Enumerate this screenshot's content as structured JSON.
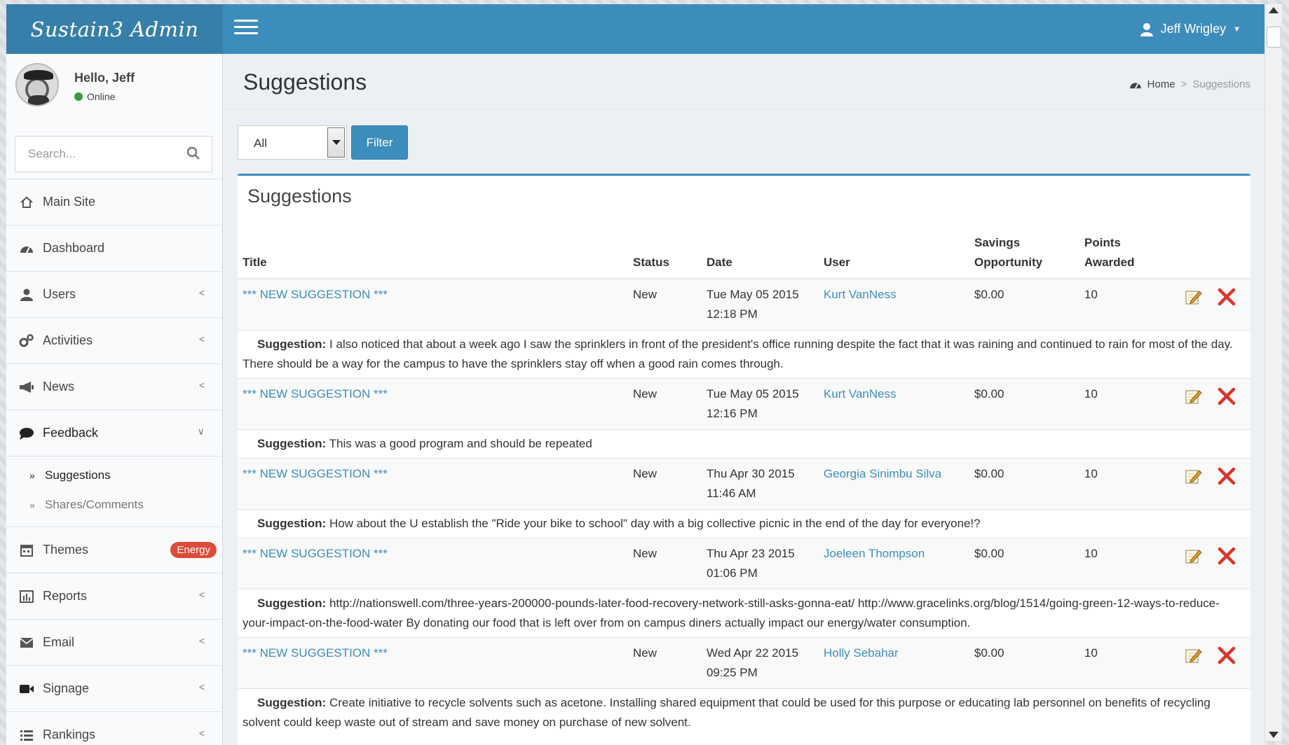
{
  "brand": "Sustain3 Admin",
  "user": {
    "name": "Jeff Wrigley",
    "greeting": "Hello, Jeff",
    "status": "Online"
  },
  "search": {
    "placeholder": "Search..."
  },
  "sidebar": {
    "items": [
      {
        "label": "Main Site",
        "icon": "home-icon"
      },
      {
        "label": "Dashboard",
        "icon": "dashboard-icon"
      },
      {
        "label": "Users",
        "icon": "user-icon"
      },
      {
        "label": "Activities",
        "icon": "gears-icon"
      },
      {
        "label": "News",
        "icon": "megaphone-icon"
      },
      {
        "label": "Feedback",
        "icon": "comment-icon"
      },
      {
        "label": "Themes",
        "icon": "calendar-icon",
        "badge": "Energy"
      },
      {
        "label": "Reports",
        "icon": "bar-chart-icon"
      },
      {
        "label": "Email",
        "icon": "envelope-icon"
      },
      {
        "label": "Signage",
        "icon": "video-camera-icon"
      },
      {
        "label": "Rankings",
        "icon": "list-icon"
      }
    ],
    "feedback_sub": [
      "Suggestions",
      "Shares/Comments"
    ]
  },
  "header": {
    "title": "Suggestions",
    "breadcrumb": {
      "home": "Home",
      "separator": ">",
      "current": "Suggestions"
    }
  },
  "filter": {
    "selected": "All",
    "button": "Filter"
  },
  "box": {
    "title": "Suggestions",
    "columns": {
      "title": "Title",
      "status": "Status",
      "date": "Date",
      "user": "User",
      "savings_1": "Savings",
      "savings_2": "Opportunity",
      "points_1": "Points",
      "points_2": "Awarded"
    },
    "suggestion_label": "Suggestion:",
    "rows": [
      {
        "title": "*** NEW SUGGESTION ***",
        "status": "New",
        "date": "Tue May 05 2015",
        "time": "12:18 PM",
        "user": "Kurt VanNess",
        "savings": "$0.00",
        "points": "10",
        "text": "I also noticed that about a week ago I saw the sprinklers in front of the president's office running despite the fact that it was raining and continued to rain for most of the day. There should be a way for the campus to have the sprinklers stay off when a good rain comes through."
      },
      {
        "title": "*** NEW SUGGESTION ***",
        "status": "New",
        "date": "Tue May 05 2015",
        "time": "12:16 PM",
        "user": "Kurt VanNess",
        "savings": "$0.00",
        "points": "10",
        "text": "This was a good program and should be repeated"
      },
      {
        "title": "*** NEW SUGGESTION ***",
        "status": "New",
        "date": "Thu Apr 30 2015",
        "time": "11:46 AM",
        "user": "Georgia Sinimbu Silva",
        "savings": "$0.00",
        "points": "10",
        "text": "How about the U establish the \"Ride your bike to school\" day with a big collective picnic in the end of the day for everyone!?"
      },
      {
        "title": "*** NEW SUGGESTION ***",
        "status": "New",
        "date": "Thu Apr 23 2015",
        "time": "01:06 PM",
        "user": "Joeleen Thompson",
        "savings": "$0.00",
        "points": "10",
        "text": "http://nationswell.com/three-years-200000-pounds-later-food-recovery-network-still-asks-gonna-eat/ http://www.gracelinks.org/blog/1514/going-green-12-ways-to-reduce-your-impact-on-the-food-water By donating our food that is left over from on campus diners actually impact our energy/water consumption."
      },
      {
        "title": "*** NEW SUGGESTION ***",
        "status": "New",
        "date": "Wed Apr 22 2015",
        "time": "09:25 PM",
        "user": "Holly Sebahar",
        "savings": "$0.00",
        "points": "10",
        "text": "Create initiative to recycle solvents such as acetone. Installing shared equipment that could be used for this purpose or educating lab personnel on benefits of recycling solvent could keep waste out of stream and save money on purchase of new solvent."
      }
    ]
  },
  "colors": {
    "header": "#3c8dbc",
    "logo_bg": "#367fa9",
    "link": "#3c8dbc",
    "badge": "#dd4b39",
    "delete": "#d9342b"
  }
}
